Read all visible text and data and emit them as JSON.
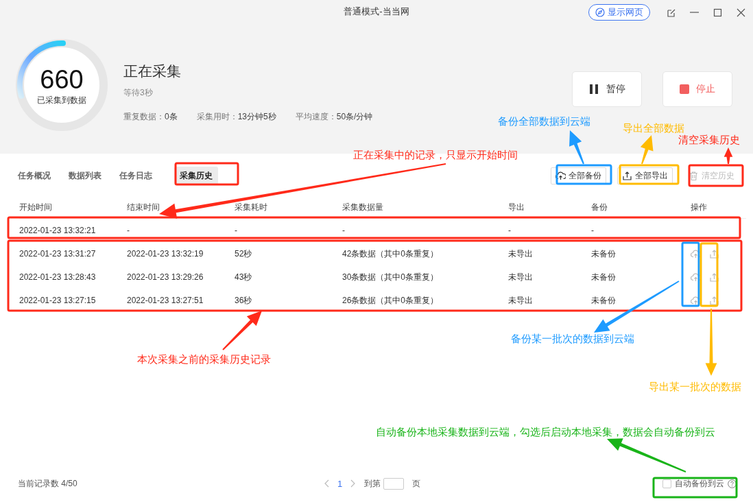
{
  "window": {
    "title": "普通模式-当当网",
    "show_webpage_button": "显示网页"
  },
  "progress": {
    "count": "660",
    "count_label": "已采集到数据",
    "status": "正在采集",
    "substatus": "等待3秒",
    "stats": [
      {
        "label": "重复数据：",
        "value": "0条"
      },
      {
        "label": "采集用时：",
        "value": "13分钟5秒"
      },
      {
        "label": "平均速度：",
        "value": "50条/分钟"
      }
    ]
  },
  "controls": [
    {
      "kind": "pause",
      "label": "暂停"
    },
    {
      "kind": "stop",
      "label": "停止"
    }
  ],
  "tabs": [
    {
      "label": "任务概况",
      "selected": false
    },
    {
      "label": "数据列表",
      "selected": false
    },
    {
      "label": "任务日志",
      "selected": false
    },
    {
      "label": "采集历史",
      "selected": true
    }
  ],
  "toolbar": [
    {
      "kind": "backup",
      "label": "全部备份",
      "disabled": false
    },
    {
      "kind": "export",
      "label": "全部导出",
      "disabled": false
    },
    {
      "kind": "clear",
      "label": "清空历史",
      "disabled": true
    }
  ],
  "table": {
    "columns": [
      "开始时间",
      "结束时间",
      "采集耗时",
      "采集数据量",
      "导出",
      "备份",
      "操作"
    ],
    "rows": [
      {
        "cells": [
          "2022-01-23 13:32:21",
          "-",
          "-",
          "-",
          "-",
          "-"
        ],
        "has_actions": false
      },
      {
        "cells": [
          "2022-01-23 13:31:27",
          "2022-01-23 13:32:19",
          "52秒",
          "42条数据（其中0条重复）",
          "未导出",
          "未备份"
        ],
        "has_actions": true
      },
      {
        "cells": [
          "2022-01-23 13:28:43",
          "2022-01-23 13:29:26",
          "43秒",
          "30条数据（其中0条重复）",
          "未导出",
          "未备份"
        ],
        "has_actions": true
      },
      {
        "cells": [
          "2022-01-23 13:27:15",
          "2022-01-23 13:27:51",
          "36秒",
          "26条数据（其中0条重复）",
          "未导出",
          "未备份"
        ],
        "has_actions": true
      }
    ]
  },
  "footer": {
    "record_count": "当前记录数 4/50",
    "page": "1",
    "goto_label": "到第",
    "page_suffix": "页",
    "auto_backup": {
      "label": "自动备份到云",
      "checked": false
    }
  },
  "annotations": [
    {
      "text": "正在采集中的记录，只显示开始时间",
      "color": "#ff2a1a"
    },
    {
      "text": "备份全部数据到云端",
      "color": "#1e9bff"
    },
    {
      "text": "导出全部数据",
      "color": "#ffbb00"
    },
    {
      "text": "清空采集历史",
      "color": "#ff2a1a"
    },
    {
      "text": "本次采集之前的采集历史记录",
      "color": "#ff2a1a"
    },
    {
      "text": "备份某一批次的数据到云端",
      "color": "#1e9bff"
    },
    {
      "text": "导出某一批次的数据",
      "color": "#ffbb00"
    },
    {
      "text": "自动备份本地采集数据到云端，勾选后启动本地采集，数据会自动备份到云",
      "color": "#19b419"
    }
  ]
}
